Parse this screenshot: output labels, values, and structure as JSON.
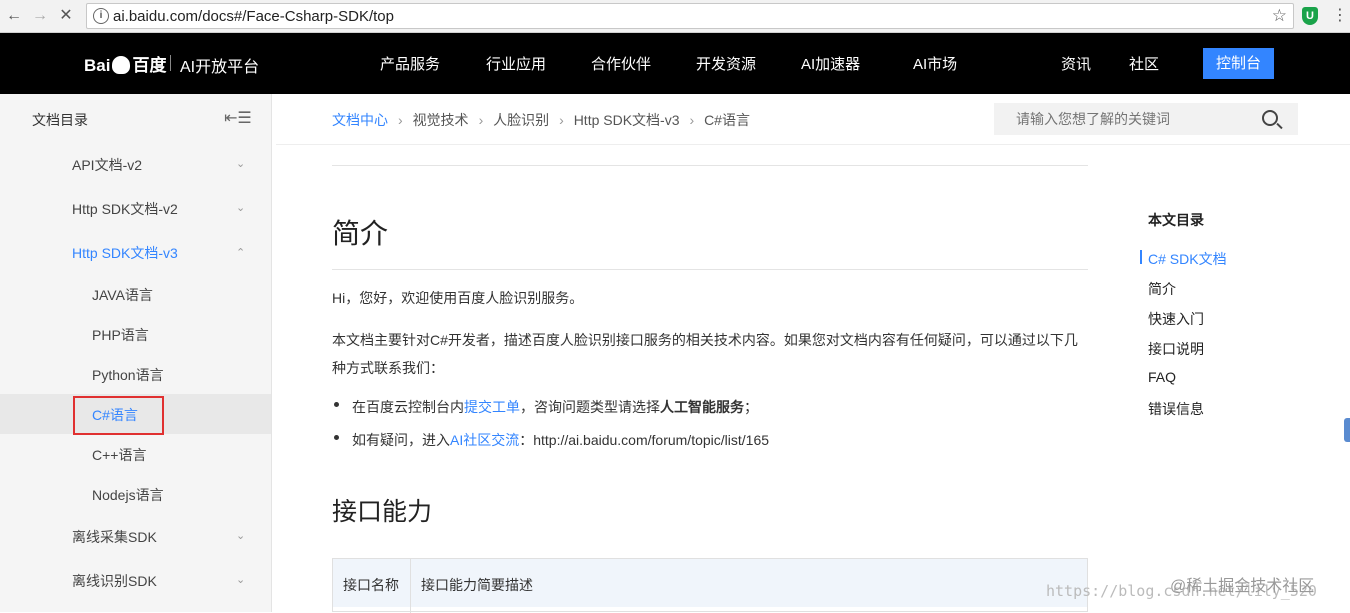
{
  "browser": {
    "url": "ai.baidu.com/docs#/Face-Csharp-SDK/top",
    "back": "←",
    "forward": "→",
    "stop": "✕",
    "info": "i",
    "star": "☆",
    "ext": "U",
    "menu": "⋮"
  },
  "header": {
    "logo_left": "Bai",
    "logo_right": "百度",
    "logo_sub": "AI开放平台",
    "nav": [
      "产品服务",
      "行业应用",
      "合作伙伴",
      "开发资源",
      "AI加速器",
      "AI市场",
      "资讯",
      "社区"
    ],
    "console": "控制台"
  },
  "sidebar": {
    "title": "文档目录",
    "collapse": "⇤☰",
    "items": [
      {
        "label": "API文档-v2",
        "chevron": "⌄"
      },
      {
        "label": "Http SDK文档-v2",
        "chevron": "⌄"
      },
      {
        "label": "Http SDK文档-v3",
        "chevron": "⌃"
      },
      {
        "label": "JAVA语言"
      },
      {
        "label": "PHP语言"
      },
      {
        "label": "Python语言"
      },
      {
        "label": "C#语言"
      },
      {
        "label": "C++语言"
      },
      {
        "label": "Nodejs语言"
      },
      {
        "label": "离线采集SDK",
        "chevron": "⌄"
      },
      {
        "label": "离线识别SDK",
        "chevron": "⌄"
      }
    ]
  },
  "breadcrumb": {
    "items": [
      "文档中心",
      "视觉技术",
      "人脸识别",
      "Http SDK文档-v3",
      "C#语言"
    ],
    "sep": "›"
  },
  "search": {
    "placeholder": "请输入您想了解的关键词"
  },
  "content": {
    "h_intro": "简介",
    "p1": "Hi，您好，欢迎使用百度人脸识别服务。",
    "p2_line1": "本文档主要针对C#开发者，描述百度人脸识别接口服务的相关技术内容。如果您对文档内容有任何疑问，可以通过以下几",
    "p2_line2": "种方式联系我们：",
    "li1_pre": "在百度云控制台内",
    "li1_link": "提交工单",
    "li1_mid": "，咨询问题类型请选择",
    "li1_bold": "人工智能服务",
    "li1_end": "；",
    "li2_pre": "如有疑问，进入",
    "li2_link": "AI社区交流",
    "li2_end": "：http://ai.baidu.com/forum/topic/list/165",
    "h_api": "接口能力",
    "table_headers": [
      "接口名称",
      "接口能力简要描述"
    ]
  },
  "toc": {
    "title": "本文目录",
    "items": [
      "C# SDK文档",
      "简介",
      "快速入门",
      "接口说明",
      "FAQ",
      "错误信息"
    ]
  },
  "watermark": {
    "url": "https://blog.csdn.net/lily_520",
    "site": "@稀土掘金技术社区"
  }
}
